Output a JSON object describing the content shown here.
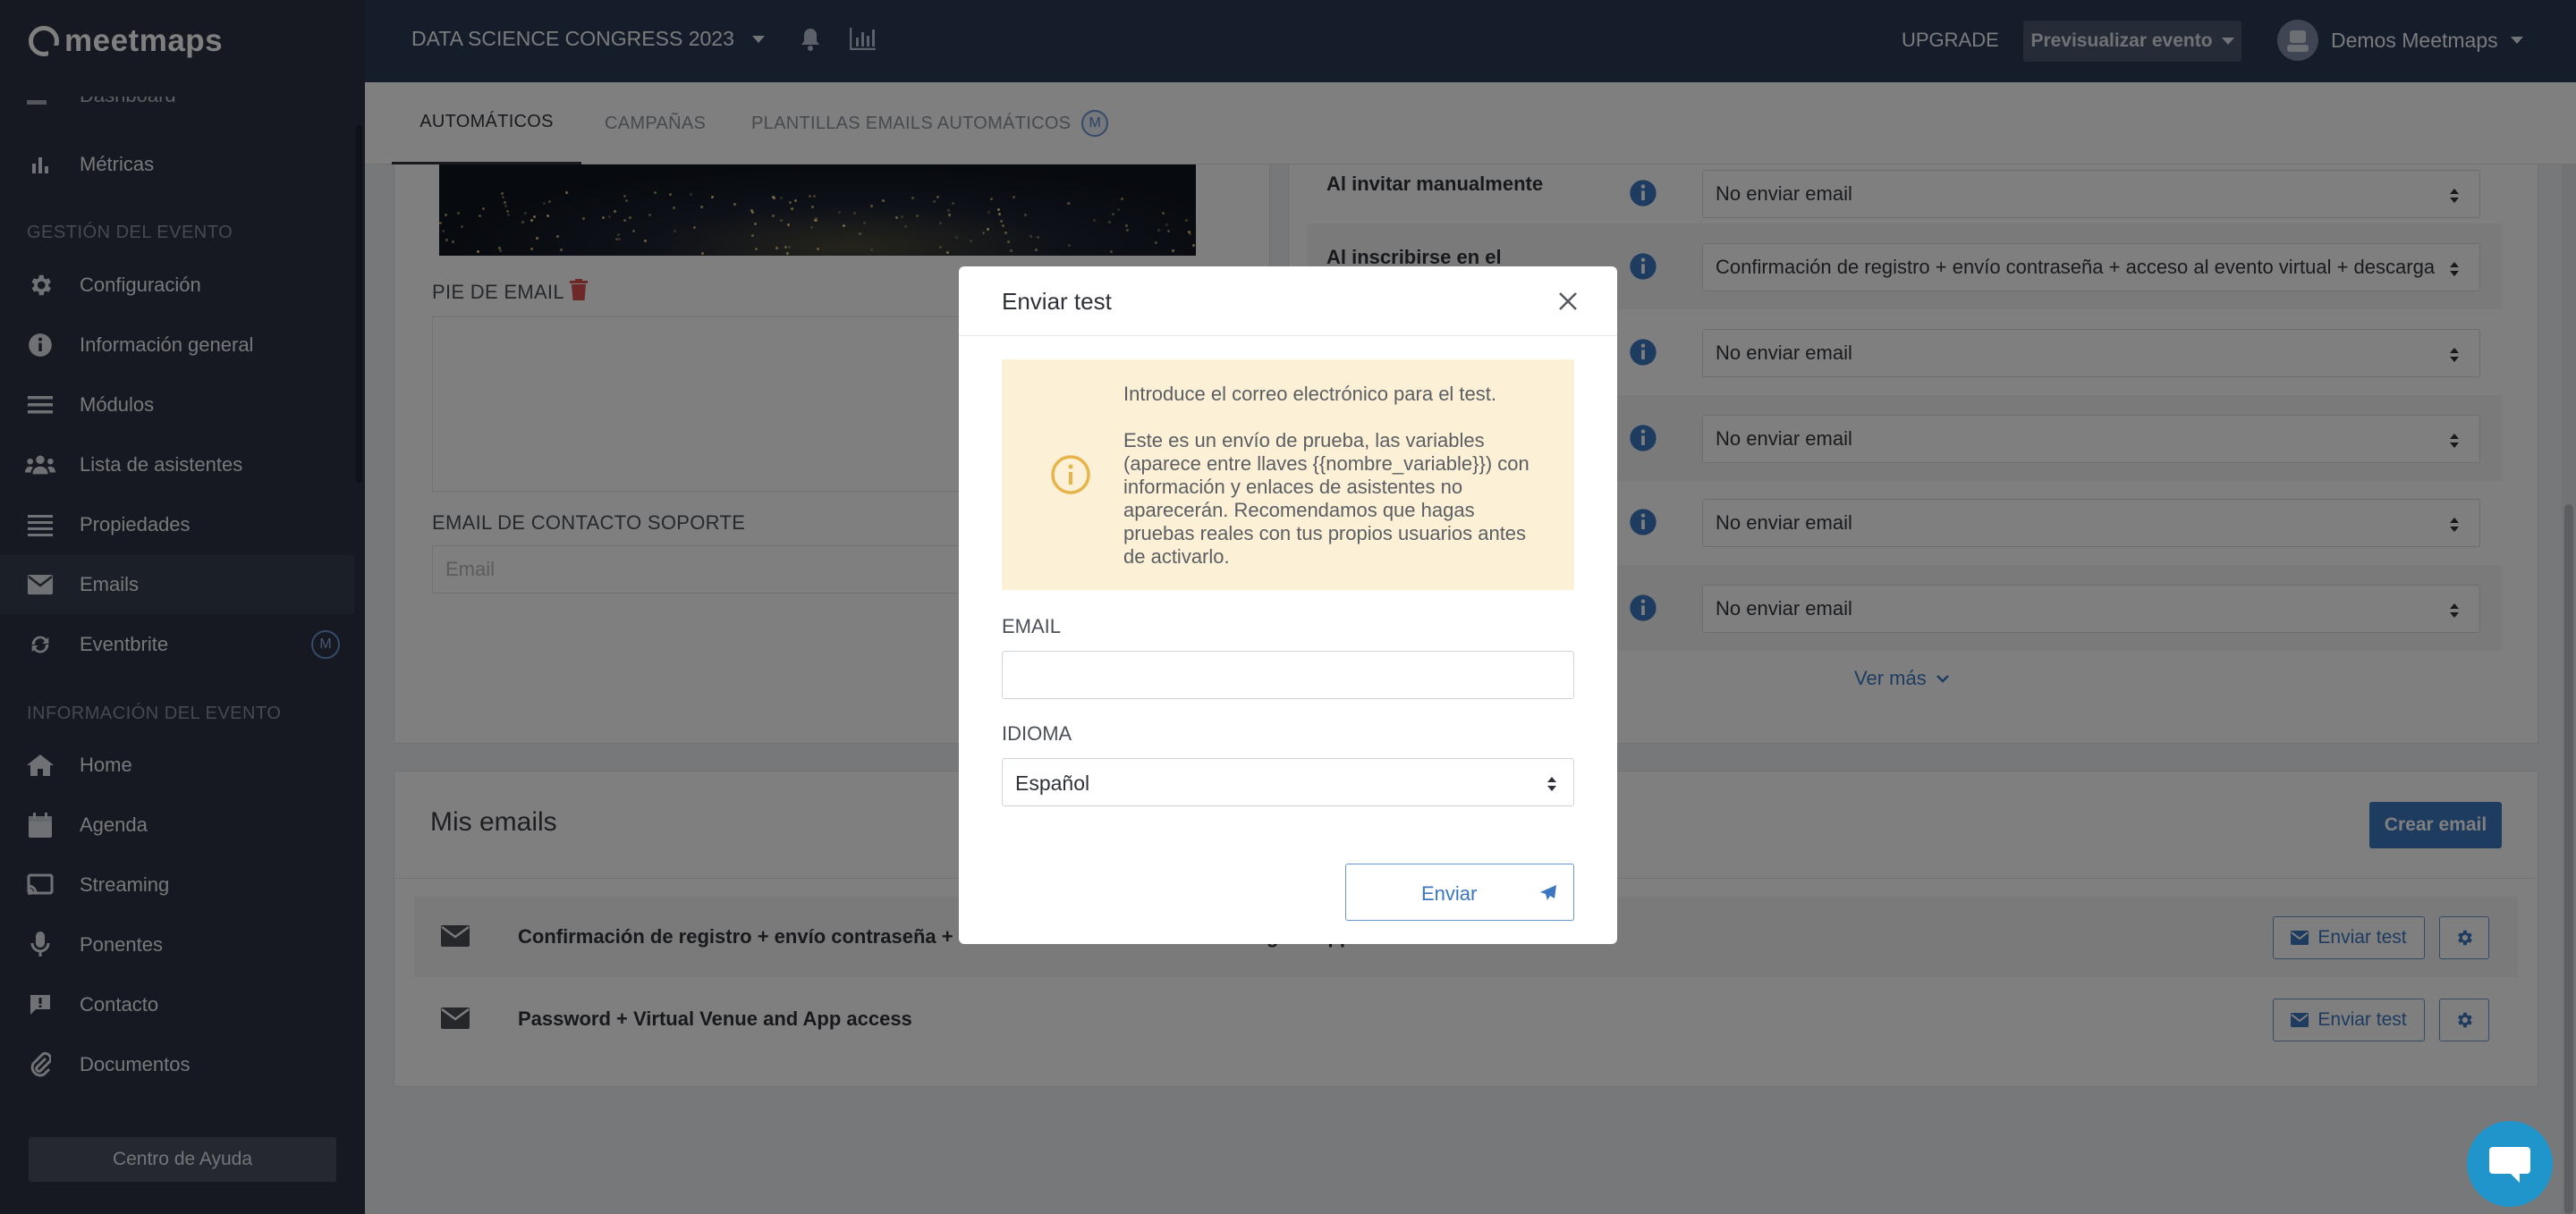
{
  "sidebar": {
    "logo": "meetmaps",
    "partial_item": "Dashboard",
    "items_top": [
      {
        "label": "Métricas",
        "icon": "bar-chart-icon"
      }
    ],
    "section_event_mgmt": "GESTIÓN DEL EVENTO",
    "items_mgmt": [
      {
        "label": "Configuración",
        "icon": "gear-icon"
      },
      {
        "label": "Información general",
        "icon": "info-icon"
      },
      {
        "label": "Módulos",
        "icon": "menu-icon"
      },
      {
        "label": "Lista de asistentes",
        "icon": "users-icon"
      },
      {
        "label": "Propiedades",
        "icon": "list-icon"
      },
      {
        "label": "Emails",
        "icon": "envelope-icon",
        "active": true
      },
      {
        "label": "Eventbrite",
        "icon": "refresh-icon",
        "badge": "M"
      }
    ],
    "section_event_info": "INFORMACIÓN DEL EVENTO",
    "items_info": [
      {
        "label": "Home",
        "icon": "home-icon"
      },
      {
        "label": "Agenda",
        "icon": "calendar-icon"
      },
      {
        "label": "Streaming",
        "icon": "cast-icon"
      },
      {
        "label": "Ponentes",
        "icon": "microphone-icon"
      },
      {
        "label": "Contacto",
        "icon": "chat-alert-icon"
      },
      {
        "label": "Documentos",
        "icon": "paperclip-icon"
      }
    ],
    "help_button": "Centro de Ayuda"
  },
  "topbar": {
    "event_name": "DATA SCIENCE CONGRESS 2023",
    "upgrade": "UPGRADE",
    "preview_button": "Previsualizar evento",
    "user_name": "Demos Meetmaps"
  },
  "tabs": [
    {
      "label": "AUTOMÁTICOS",
      "active": true
    },
    {
      "label": "CAMPAÑAS"
    },
    {
      "label": "PLANTILLAS EMAILS AUTOMÁTICOS",
      "badge": "M"
    }
  ],
  "left_card": {
    "footer_label": "PIE DE EMAIL",
    "support_label": "EMAIL DE CONTACTO SOPORTE",
    "support_placeholder": "Email"
  },
  "rules": [
    {
      "label": "Al invitar manualmente",
      "value": "No enviar email"
    },
    {
      "label": "Al inscribirse en el",
      "value": "Confirmación de registro + envío contraseña + acceso al evento virtual + descarga"
    },
    {
      "label": "",
      "value": "No enviar email"
    },
    {
      "label": "",
      "value": "No enviar email"
    },
    {
      "label": "",
      "value": "No enviar email"
    },
    {
      "label": "",
      "value": "No enviar email"
    }
  ],
  "ver_mas": "Ver más",
  "my_emails": {
    "title": "Mis emails",
    "create_button": "Crear email",
    "rows": [
      {
        "name": "Confirmación de registro + envío contraseña + acceso al evento virtual + descarga la app",
        "test_button": "Enviar test"
      },
      {
        "name": "Password + Virtual Venue and App access",
        "test_button": "Enviar test"
      }
    ]
  },
  "modal": {
    "title": "Enviar test",
    "alert_line1": "Introduce el correo electrónico para el test.",
    "alert_line2": "Este es un envío de prueba, las variables (aparece entre llaves {{nombre_variable}}) con información y enlaces de asistentes no aparecerán. Recomendamos que hagas pruebas reales con tus propios usuarios antes de activarlo.",
    "email_label": "EMAIL",
    "email_value": "",
    "language_label": "IDIOMA",
    "language_value": "Español",
    "send_button": "Enviar"
  },
  "colors": {
    "sidebar_bg": "#2c3342",
    "topbar_bg": "#2d3a55",
    "accent": "#3c76c0",
    "alert_bg": "#fcf0d6",
    "alert_icon": "#e8b44a",
    "trash": "#d9534f",
    "chat_fab": "#1f95cc"
  }
}
